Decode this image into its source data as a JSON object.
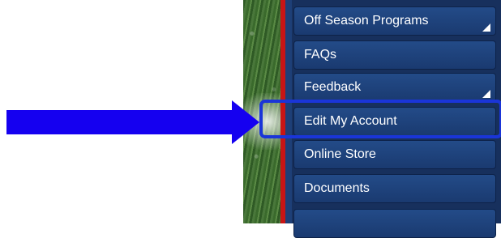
{
  "menu": {
    "items": [
      {
        "label": "Off Season Programs",
        "has_submenu": true
      },
      {
        "label": "FAQs",
        "has_submenu": false
      },
      {
        "label": "Feedback",
        "has_submenu": true
      },
      {
        "label": "Edit My Account",
        "has_submenu": false,
        "highlighted": true
      },
      {
        "label": "Online Store",
        "has_submenu": false
      },
      {
        "label": "Documents",
        "has_submenu": false
      }
    ]
  },
  "annotation": {
    "arrow_color": "#1500F0",
    "highlight_color": "#1A35D8",
    "points_to": "Edit My Account"
  },
  "colors": {
    "menu_bg": "#1E3F77",
    "menu_border": "#C81515",
    "text": "#FFFFFF"
  }
}
